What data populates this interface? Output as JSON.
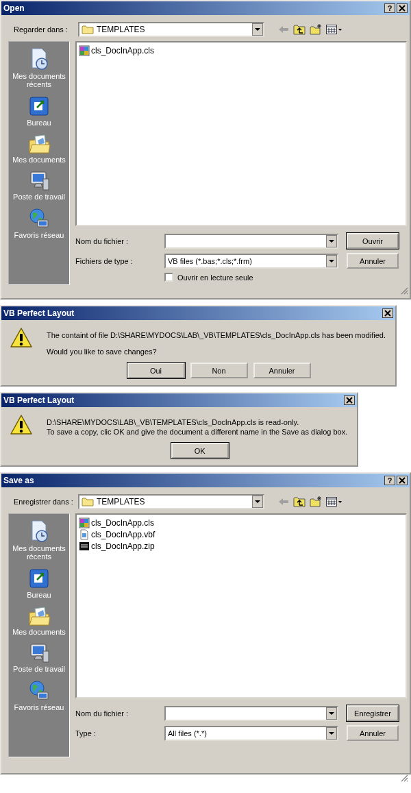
{
  "dialogs": [
    {
      "kind": "file",
      "title": "Open",
      "help_button": "?",
      "look_in_label": "Regarder dans :",
      "folder": "TEMPLATES",
      "places": [
        {
          "kind": "recent",
          "label": "Mes documents récents"
        },
        {
          "kind": "desktop",
          "label": "Bureau"
        },
        {
          "kind": "documents",
          "label": "Mes documents"
        },
        {
          "kind": "computer",
          "label": "Poste de travail"
        },
        {
          "kind": "network",
          "label": "Favoris réseau"
        }
      ],
      "files": [
        {
          "kind": "cls",
          "name": "cls_DocInApp.cls"
        }
      ],
      "filename_label": "Nom du fichier :",
      "type_label": "Fichiers de type :",
      "type_value": "VB files (*.bas;*.cls;*.frm)",
      "checkbox": {
        "label": "Ouvrir en lecture seule",
        "checked": false
      },
      "buttons": [
        {
          "label": "Ouvrir",
          "default": true
        },
        {
          "label": "Annuler",
          "default": false
        }
      ]
    },
    {
      "kind": "message",
      "title": "VB Perfect Layout",
      "paragraphs": [
        [
          "The containt of file D:\\SHARE\\MYDOCS\\LAB\\_VB\\TEMPLATES\\cls_DocInApp.cls has been modified."
        ],
        [
          "Would you like to save changes?"
        ]
      ],
      "buttons": [
        {
          "label": "Oui",
          "default": true
        },
        {
          "label": "Non",
          "default": false
        },
        {
          "label": "Annuler",
          "default": false
        }
      ]
    },
    {
      "kind": "message",
      "title": "VB Perfect Layout",
      "paragraphs": [
        [
          "D:\\SHARE\\MYDOCS\\LAB\\_VB\\TEMPLATES\\cls_DocInApp.cls is read-only.",
          "To save a copy, clic OK and give the document a different name in the Save as dialog box."
        ]
      ],
      "buttons": [
        {
          "label": "OK",
          "default": true
        }
      ]
    },
    {
      "kind": "file",
      "title": "Save as",
      "help_button": "?",
      "look_in_label": "Enregistrer dans :",
      "folder": "TEMPLATES",
      "places": [
        {
          "kind": "recent",
          "label": "Mes documents récents"
        },
        {
          "kind": "desktop",
          "label": "Bureau"
        },
        {
          "kind": "documents",
          "label": "Mes documents"
        },
        {
          "kind": "computer",
          "label": "Poste de travail"
        },
        {
          "kind": "network",
          "label": "Favoris réseau"
        }
      ],
      "files": [
        {
          "kind": "cls",
          "name": "cls_DocInApp.cls"
        },
        {
          "kind": "vbf",
          "name": "cls_DocInApp.vbf"
        },
        {
          "kind": "zip",
          "name": "cls_DocInApp.zip"
        }
      ],
      "filename_label": "Nom du fichier :",
      "type_label": "Type :",
      "type_value": "All files (*.*)",
      "buttons": [
        {
          "label": "Enregistrer",
          "default": true
        },
        {
          "label": "Annuler",
          "default": false
        }
      ]
    }
  ]
}
